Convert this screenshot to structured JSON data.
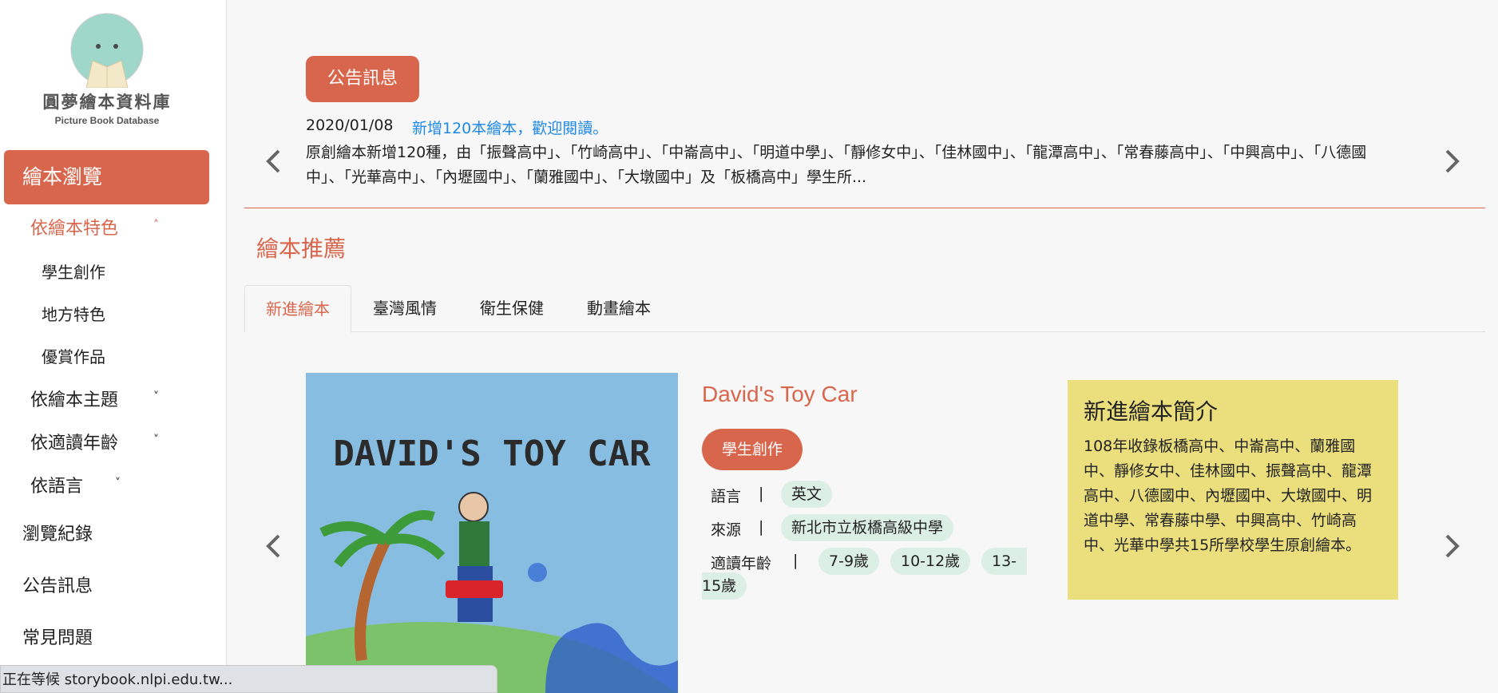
{
  "logo": {
    "name_cn": "圓夢繪本資料庫",
    "name_en": "Picture Book Database"
  },
  "sidebar": {
    "primary_label": "繪本瀏覽",
    "category_feature": "依繪本特色",
    "feature_items": [
      "學生創作",
      "地方特色",
      "優賞作品"
    ],
    "category_topic": "依繪本主題",
    "category_age": "依適讀年齡",
    "category_language": "依語言",
    "history": "瀏覽紀錄",
    "announcements": "公告訊息",
    "faq": "常見問題"
  },
  "announcement": {
    "button_label": "公告訊息",
    "date": "2020/01/08",
    "link_text": "新增120本繪本，歡迎閱讀。",
    "body": "原創繪本新增120種，由「振聲高中」、「竹崎高中」、「中崙高中」、「明道中學」、「靜修女中」、「佳林國中」、「龍潭高中」、「常春藤高中」、「中興高中」、「八德國中」、「光華高中」、「內壢國中」、「蘭雅國中」、「大墩國中」及「板橋高中」學生所..."
  },
  "recommend": {
    "title": "繪本推薦",
    "tabs": [
      "新進繪本",
      "臺灣風情",
      "衛生保健",
      "動畫繪本"
    ],
    "active_tab": 0
  },
  "book": {
    "cover_text": "DAVID'S TOY CAR",
    "title": "David's Toy Car",
    "badge": "學生創作",
    "language_label": "語言",
    "language": "英文",
    "source_label": "來源",
    "source": "新北市立板橋高級中學",
    "age_label": "適讀年齡",
    "ages": [
      "7-9歲",
      "10-12歲",
      "13-",
      "15歲"
    ],
    "separator": "|"
  },
  "intro": {
    "title": "新進繪本簡介",
    "body": "108年收錄板橋高中、中崙高中、蘭雅國中、靜修女中、佳林國中、振聲高中、龍潭高中、八德國中、內壢國中、大墩國中、明道中學、常春藤中學、中興高中、竹崎高中、光華中學共15所學校學生原創繪本。"
  },
  "status_bar": {
    "text": "正在等候 storybook.nlpi.edu.tw..."
  },
  "colors": {
    "accent": "#d8664d",
    "link": "#1e88e5",
    "pill": "#dcefe5",
    "intro_bg": "#ebde7c"
  }
}
